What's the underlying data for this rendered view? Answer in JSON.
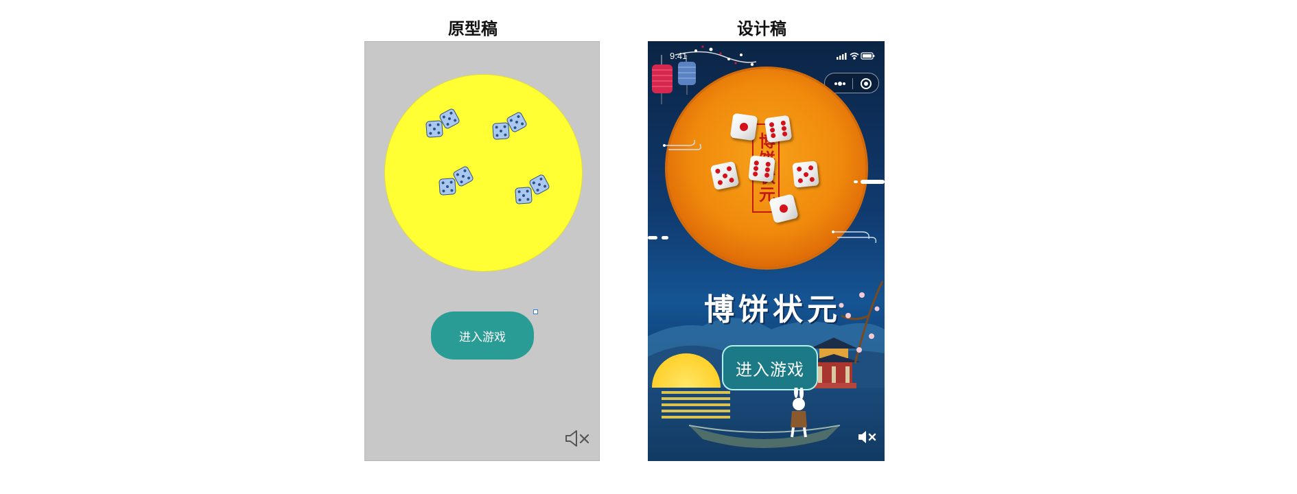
{
  "titles": {
    "prototype": "原型稿",
    "design": "设计稿"
  },
  "prototype": {
    "enter_button": "进入游戏",
    "icons": {
      "dice": "dice-icon",
      "mute": "speaker-mute-icon"
    }
  },
  "design": {
    "status_time": "9:41",
    "game_title": "博饼状元",
    "stamp_text": "博饼状元",
    "enter_button": "进入游戏",
    "icons": {
      "signal": "signal-icon",
      "wifi": "wifi-icon",
      "battery": "battery-icon",
      "more": "more-dots-icon",
      "close": "close-target-icon",
      "mute": "speaker-mute-icon",
      "lantern": "lantern-icon",
      "pagoda": "pagoda-icon",
      "rabbit": "rabbit-icon",
      "boat": "boat-icon"
    },
    "colors": {
      "bowl": "#f08a0c",
      "button": "#1c7a86",
      "moon": "#ffd12b",
      "background": "#103a6e"
    }
  },
  "colors": {
    "prototype_bg": "#c8c8c8",
    "prototype_bowl": "#ffff33",
    "prototype_button": "#2a9c96"
  }
}
